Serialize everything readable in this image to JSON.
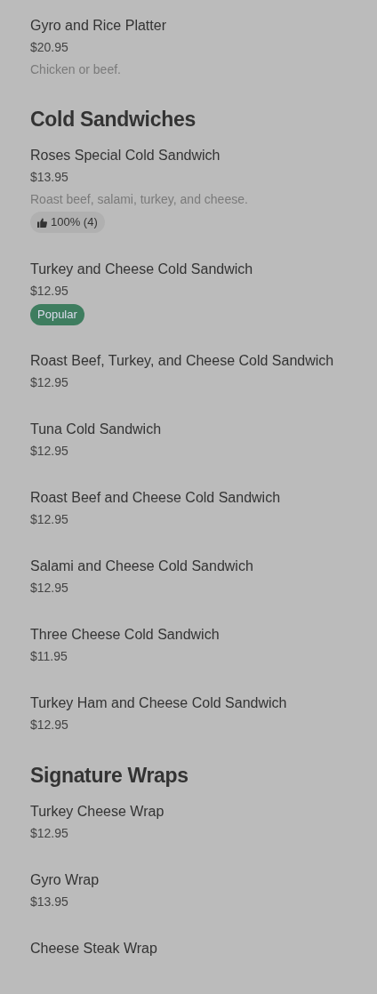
{
  "sections": [
    {
      "items": [
        {
          "name": "Gyro and Rice Platter",
          "price": "$20.95",
          "description": "Chicken or beef."
        }
      ]
    },
    {
      "title": "Cold Sandwiches",
      "items": [
        {
          "name": "Roses Special Cold Sandwich",
          "price": "$13.95",
          "description": "Roast beef, salami, turkey, and cheese.",
          "badges": [
            {
              "kind": "rating",
              "text": "100% (4)"
            }
          ]
        },
        {
          "name": "Turkey and Cheese Cold Sandwich",
          "price": "$12.95",
          "badges": [
            {
              "kind": "tag",
              "text": "Popular"
            }
          ]
        },
        {
          "name": "Roast Beef, Turkey, and Cheese Cold Sandwich",
          "price": "$12.95"
        },
        {
          "name": "Tuna Cold Sandwich",
          "price": "$12.95"
        },
        {
          "name": "Roast Beef and Cheese Cold Sandwich",
          "price": "$12.95"
        },
        {
          "name": "Salami and Cheese Cold Sandwich",
          "price": "$12.95"
        },
        {
          "name": "Three Cheese Cold Sandwich",
          "price": "$11.95"
        },
        {
          "name": "Turkey Ham and Cheese Cold Sandwich",
          "price": "$12.95"
        }
      ]
    },
    {
      "title": "Signature Wraps",
      "items": [
        {
          "name": "Turkey Cheese Wrap",
          "price": "$12.95"
        },
        {
          "name": "Gyro Wrap",
          "price": "$13.95"
        },
        {
          "name": "Cheese Steak Wrap"
        }
      ]
    }
  ]
}
